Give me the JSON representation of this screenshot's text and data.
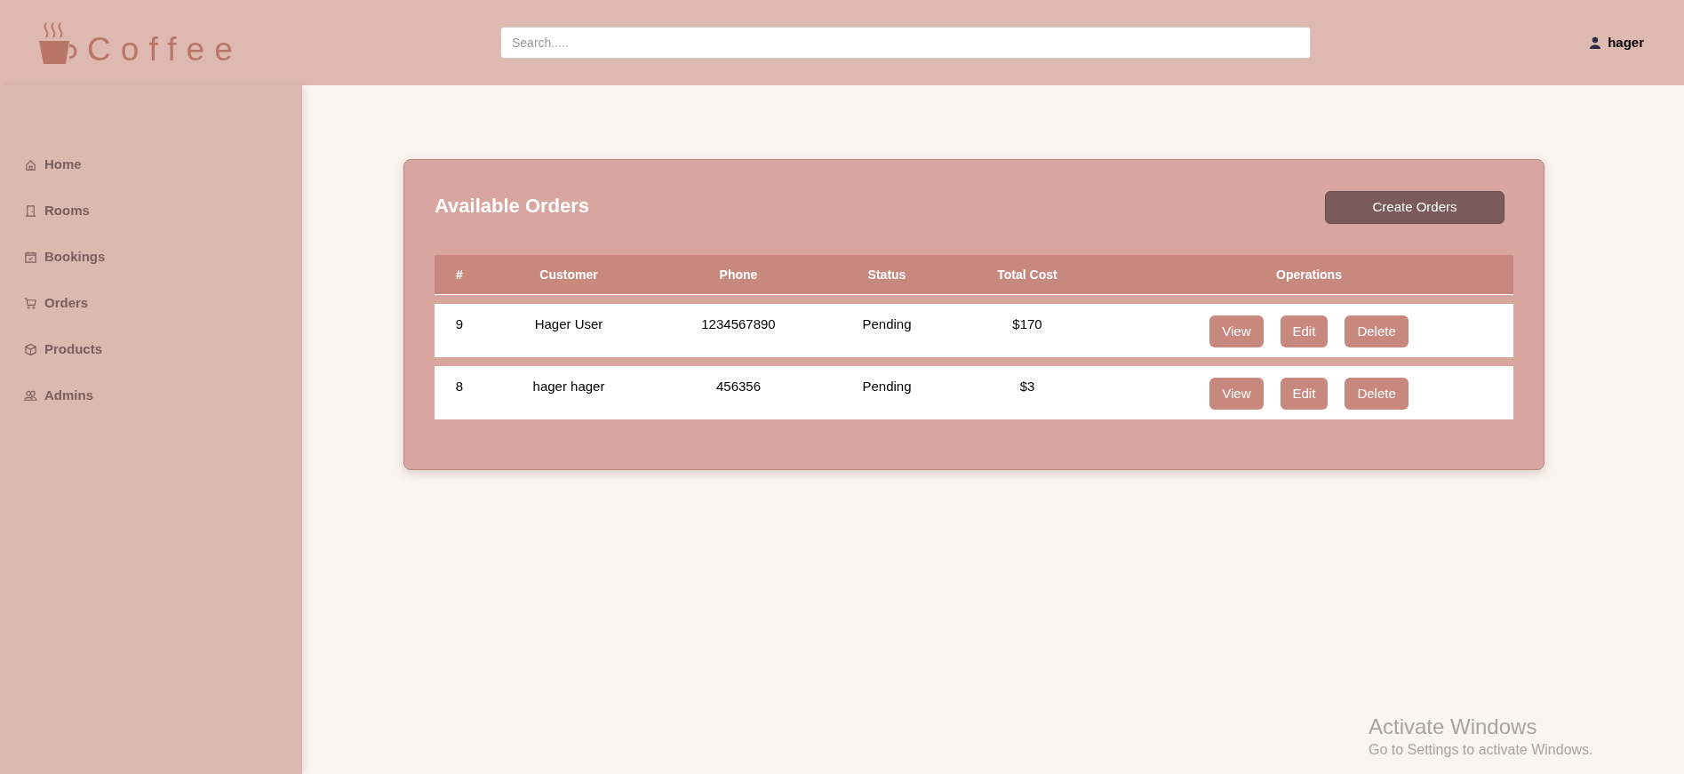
{
  "header": {
    "logo_text": "Coffee",
    "search": {
      "placeholder": "Search....."
    },
    "user": {
      "name": "hager"
    }
  },
  "sidebar": {
    "items": [
      {
        "label": "Home",
        "selected": false
      },
      {
        "label": "Rooms",
        "selected": false
      },
      {
        "label": "Bookings",
        "selected": false
      },
      {
        "label": "Orders",
        "selected": false
      },
      {
        "label": "Products",
        "selected": false
      },
      {
        "label": "Admins",
        "selected": false
      }
    ]
  },
  "orders_card": {
    "title": "Available Orders",
    "create_button": "Create Orders",
    "table": {
      "columns": [
        "#",
        "Customer",
        "Phone",
        "Status",
        "Total Cost",
        "Operations"
      ],
      "rows": [
        {
          "cells": [
            "9",
            "Hager User",
            "1234567890",
            "Pending",
            "$170"
          ],
          "actions": [
            "View",
            "Edit",
            "Delete"
          ]
        },
        {
          "cells": [
            "8",
            "hager hager",
            "456356",
            "Pending",
            "$3"
          ],
          "actions": [
            "View",
            "Edit",
            "Delete"
          ]
        }
      ]
    }
  },
  "windows_notice": {
    "title": "Activate Windows",
    "subtitle": "Go to Settings to activate Windows."
  }
}
